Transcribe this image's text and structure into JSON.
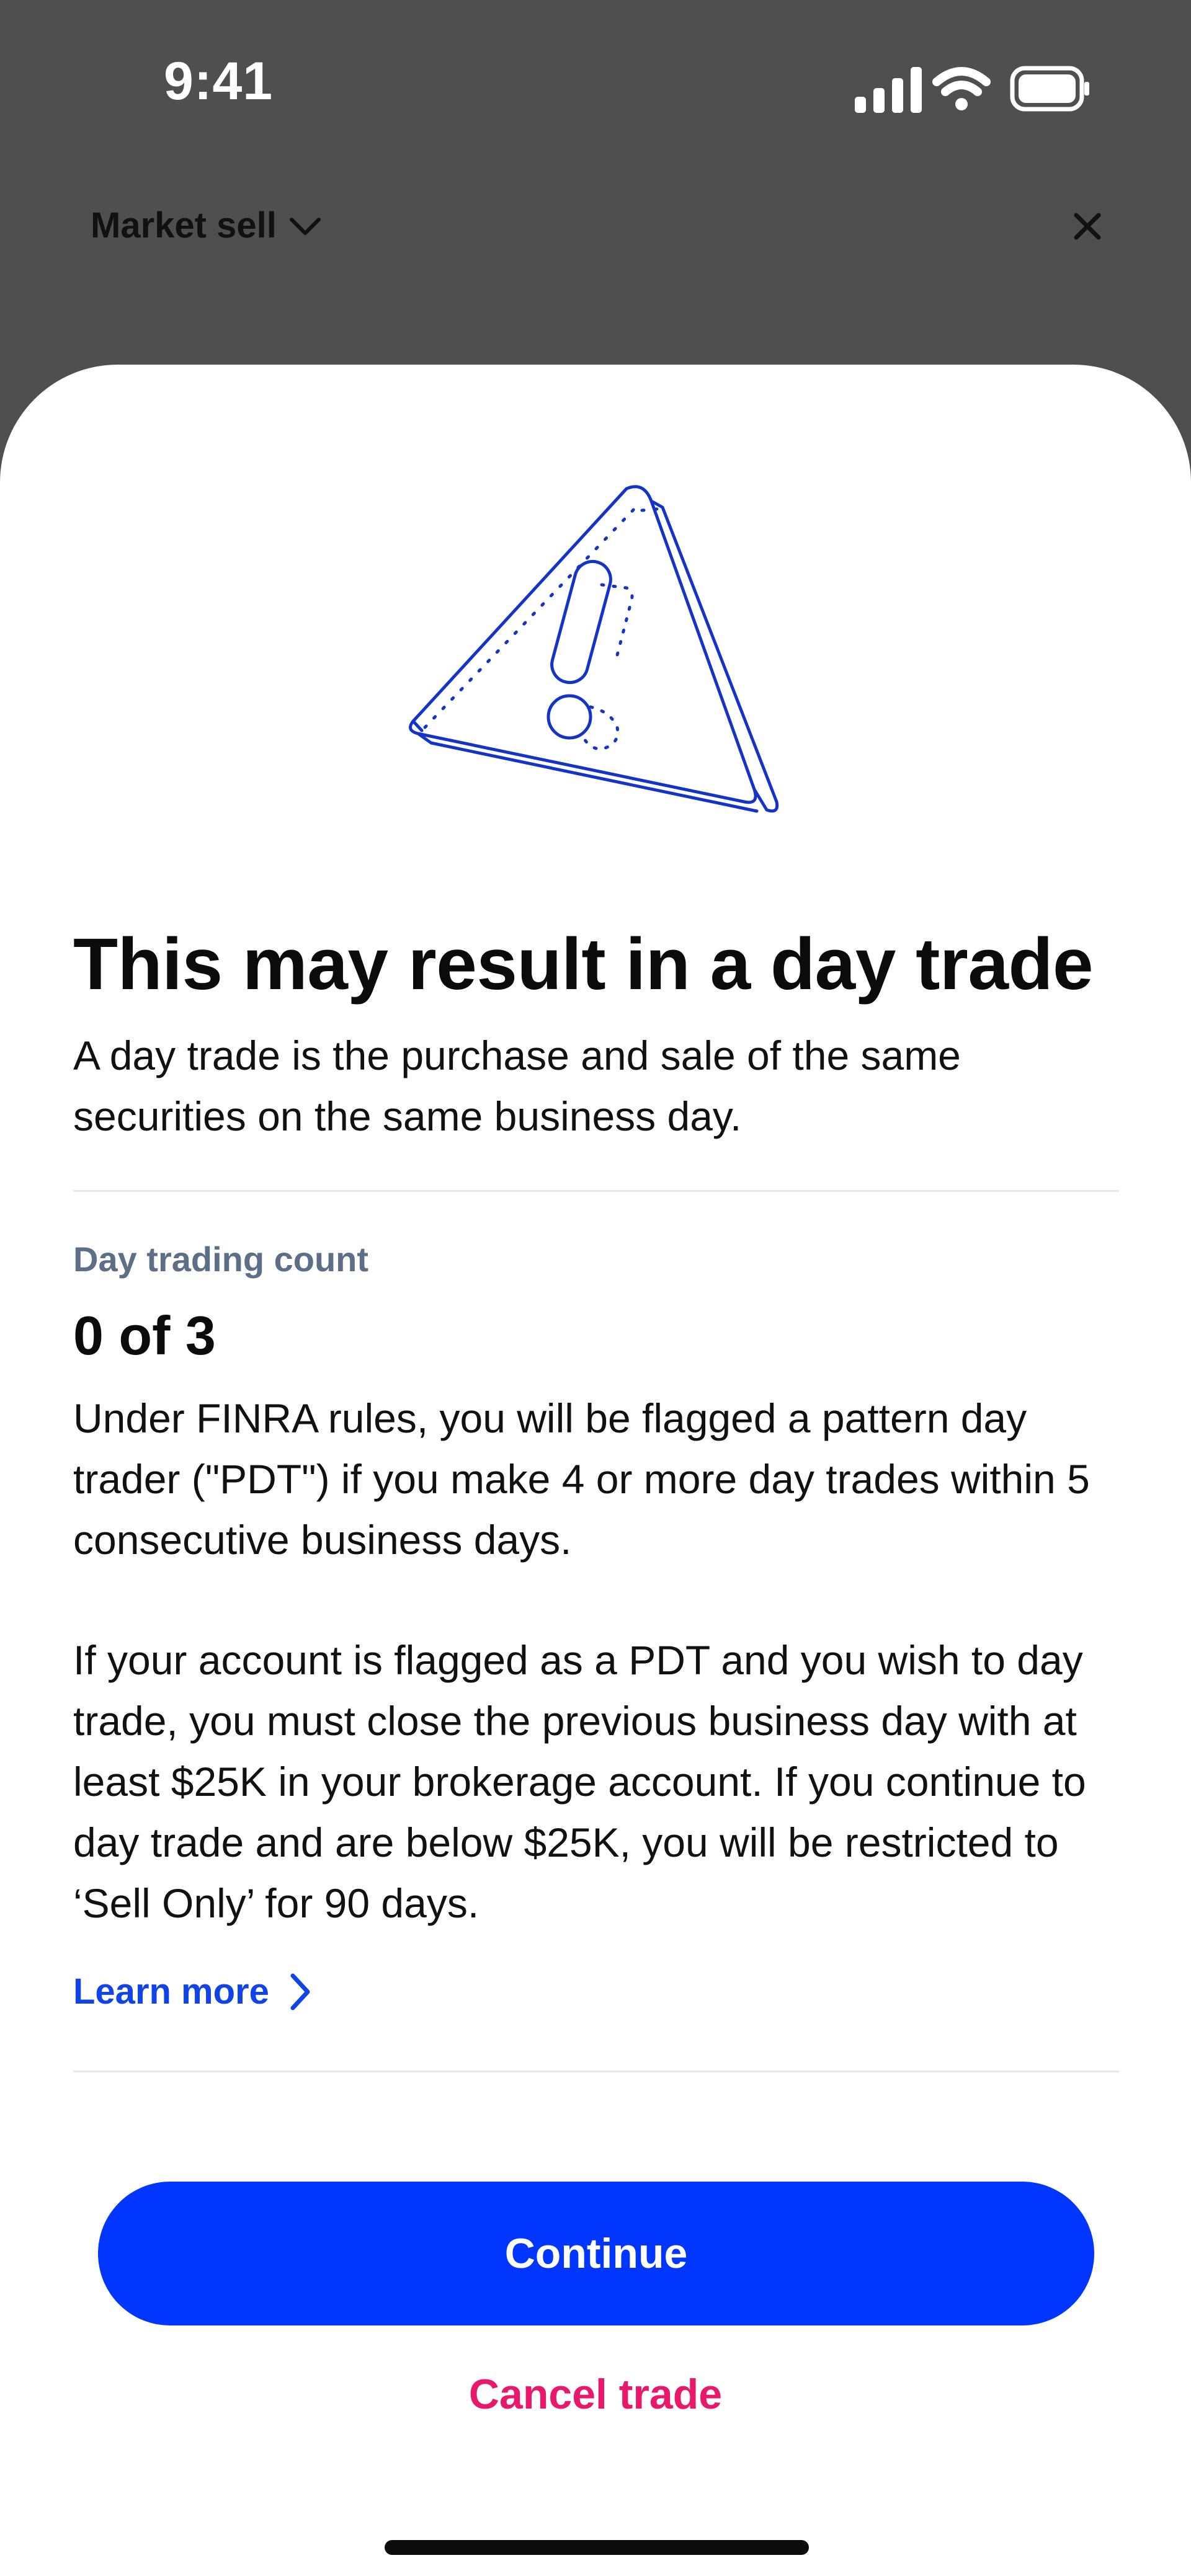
{
  "status_bar": {
    "time": "9:41",
    "icons": [
      "signal-icon",
      "wifi-icon",
      "battery-icon"
    ]
  },
  "header": {
    "order_type": "Market sell",
    "dropdown_icon": "chevron-down-icon",
    "close_icon": "close-icon"
  },
  "sheet": {
    "illustration_icon": "warning-triangle-illustration",
    "title": "This may result in a day trade",
    "intro": "A day trade is the purchase and sale of the same securities on the same business day.",
    "count_label": "Day trading count",
    "count_value": "0 of 3",
    "rules_text": "Under FINRA rules, you will be flagged a pattern day trader (\"PDT\") if you make 4 or more day trades within 5 consecutive business days.",
    "pdt_text": "If your account is flagged as a PDT and you wish to day trade, you must close the previous business day with at least $25K in your brokerage account. If you continue to day trade and are below $25K, you will be restricted to ‘Sell Only’ for 90 days.",
    "learn_more": "Learn more",
    "learn_more_icon": "chevron-right-icon",
    "continue_label": "Continue",
    "cancel_label": "Cancel trade"
  },
  "colors": {
    "backdrop": "#4f4f4f",
    "sheet_background": "#ffffff",
    "primary": "#0036ff",
    "link": "#1144e6",
    "cancel": "#e8196b",
    "illustration_stroke": "#1433c9",
    "muted_label": "#5c6f87",
    "divider": "#e6e8eb"
  }
}
